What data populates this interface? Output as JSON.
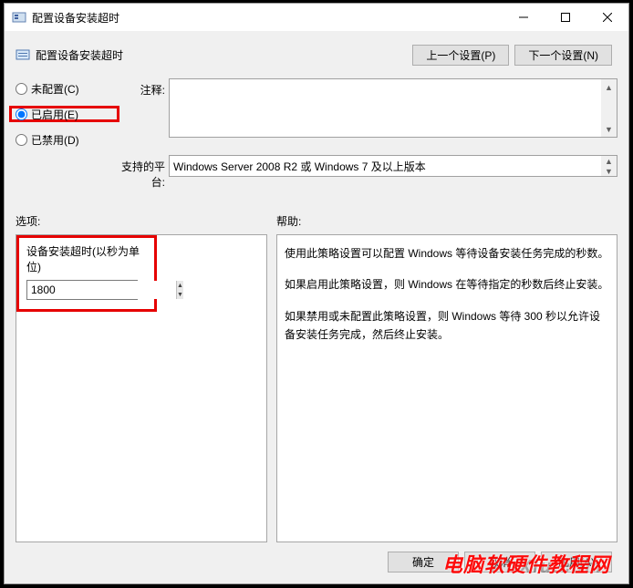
{
  "window": {
    "title": "配置设备安装超时"
  },
  "header": {
    "title": "配置设备安装超时",
    "prev_button": "上一个设置(P)",
    "next_button": "下一个设置(N)"
  },
  "radios": {
    "not_configured": "未配置(C)",
    "enabled": "已启用(E)",
    "disabled": "已禁用(D)",
    "selected": "enabled"
  },
  "labels": {
    "comment": "注释:",
    "supported": "支持的平台:",
    "options": "选项:",
    "help": "帮助:"
  },
  "comment_text": "",
  "supported_text": "Windows Server 2008 R2 或 Windows 7 及以上版本",
  "option": {
    "label": "设备安装超时(以秒为单位)",
    "value": "1800"
  },
  "help_paragraphs": [
    "使用此策略设置可以配置 Windows 等待设备安装任务完成的秒数。",
    "如果启用此策略设置，则 Windows 在等待指定的秒数后终止安装。",
    "如果禁用或未配置此策略设置，则 Windows 等待 300 秒以允许设备安装任务完成，然后终止安装。"
  ],
  "footer": {
    "ok": "确定",
    "cancel": "取消",
    "apply": "应用(A)"
  },
  "watermark": "电脑软硬件教程网",
  "watermark2": "AnXiu.com"
}
